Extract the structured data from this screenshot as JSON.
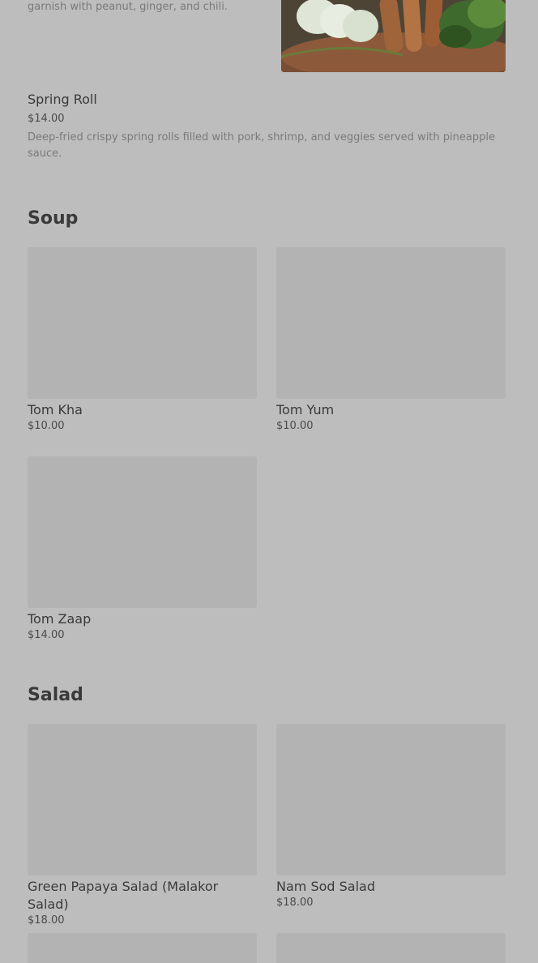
{
  "partial_item": {
    "desc": "garnish with peanut, ginger, and chili."
  },
  "spring_roll": {
    "name": "Spring Roll",
    "price": "$14.00",
    "desc": "Deep-fried crispy spring rolls filled with pork, shrimp, and veggies served with pineapple sauce."
  },
  "sections": {
    "soup": {
      "title": "Soup",
      "items": [
        {
          "name": "Tom Kha",
          "price": "$10.00"
        },
        {
          "name": "Tom Yum",
          "price": "$10.00"
        },
        {
          "name": "Tom Zaap",
          "price": "$14.00"
        }
      ]
    },
    "salad": {
      "title": "Salad",
      "items": [
        {
          "name": "Green Papaya Salad (Malakor Salad)",
          "price": "$18.00"
        },
        {
          "name": "Nam Sod Salad",
          "price": "$18.00"
        }
      ]
    }
  },
  "colors": {
    "overlay_bg": "#bdbdbd",
    "placeholder": "#b3b3b3",
    "text_primary": "#3a3a3a",
    "text_muted": "#7a7a7a"
  }
}
